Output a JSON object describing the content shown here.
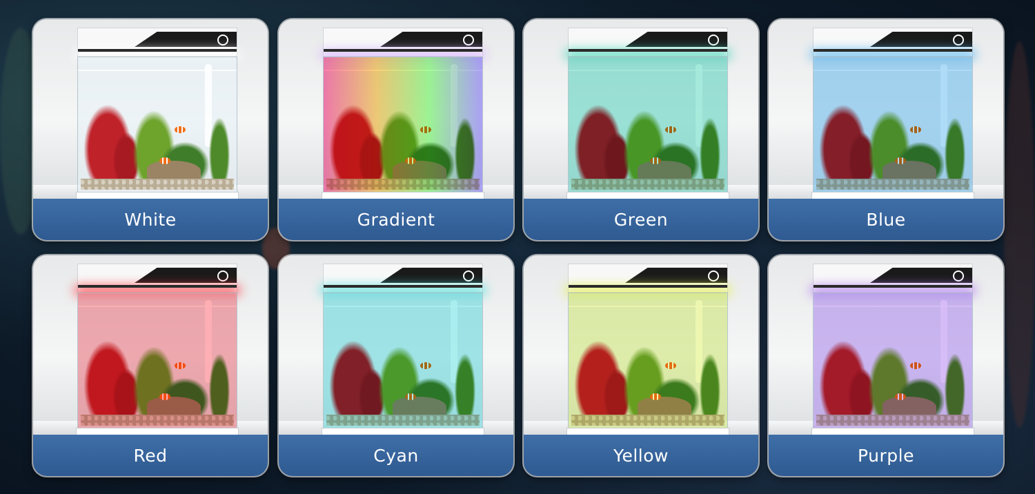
{
  "cards": [
    {
      "label": "White",
      "tint": "rgba(255,255,255,0)",
      "glow": "#ffffff"
    },
    {
      "label": "Gradient",
      "tint": "linear-gradient(90deg,#ff7fb0,#ffd27a,#a8ff9a,#b9a8ff)",
      "glow": "#d6b4ff"
    },
    {
      "label": "Green",
      "tint": "rgba(60,210,180,0.45)",
      "glow": "#44d6b8"
    },
    {
      "label": "Blue",
      "tint": "rgba(80,180,240,0.45)",
      "glow": "#5ab8f0"
    },
    {
      "label": "Red",
      "tint": "rgba(255,80,90,0.45)",
      "glow": "#ff3b45"
    },
    {
      "label": "Cyan",
      "tint": "rgba(70,220,220,0.45)",
      "glow": "#4fe0dc"
    },
    {
      "label": "Yellow",
      "tint": "rgba(220,240,80,0.45)",
      "glow": "#e3f04a"
    },
    {
      "label": "Purple",
      "tint": "rgba(170,110,240,0.45)",
      "glow": "#b07af0"
    }
  ]
}
